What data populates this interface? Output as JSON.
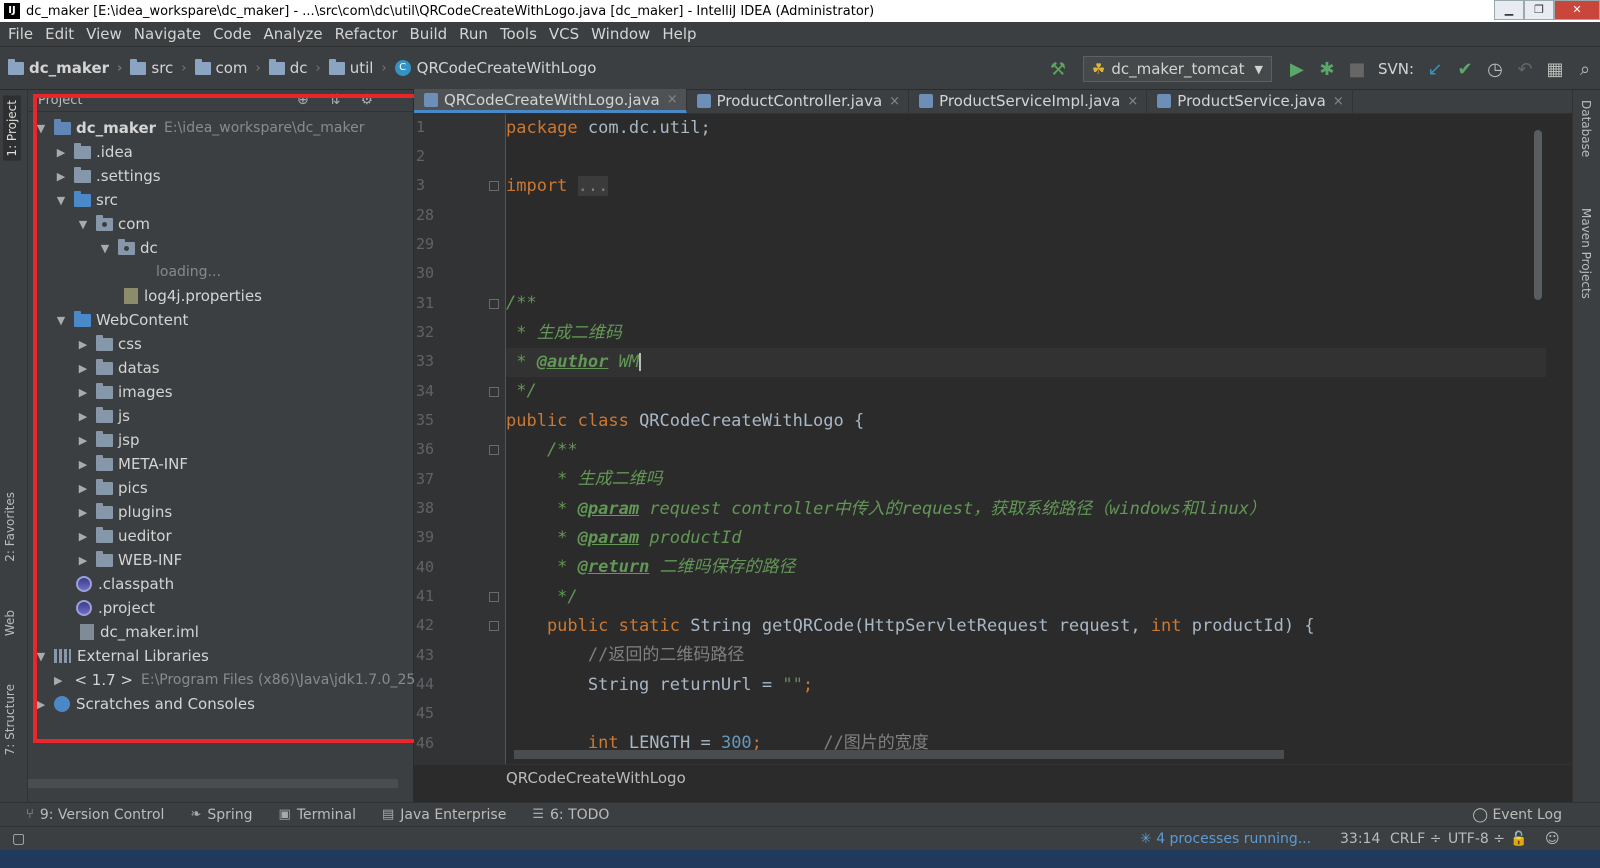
{
  "window": {
    "title": "dc_maker [E:\\idea_workspare\\dc_maker] - ...\\src\\com\\dc\\util\\QRCodeCreateWithLogo.java [dc_maker] - IntelliJ IDEA (Administrator)"
  },
  "menu": [
    "File",
    "Edit",
    "View",
    "Navigate",
    "Code",
    "Analyze",
    "Refactor",
    "Build",
    "Run",
    "Tools",
    "VCS",
    "Window",
    "Help"
  ],
  "navbar": {
    "crumbs": [
      "dc_maker",
      "src",
      "com",
      "dc",
      "util",
      "QRCodeCreateWithLogo"
    ],
    "run_config": "dc_maker_tomcat",
    "svn_label": "SVN:"
  },
  "left_stripe": {
    "project": "1: Project",
    "favorites": "2: Favorites",
    "web": "Web",
    "structure": "7: Structure"
  },
  "right_stripe": {
    "database": "Database",
    "maven": "Maven Projects"
  },
  "project_panel": {
    "header": "Project",
    "tree": [
      {
        "name": "dc_maker",
        "path": "E:\\idea_workspare\\dc_maker"
      },
      {
        "name": ".idea"
      },
      {
        "name": ".settings"
      },
      {
        "name": "src"
      },
      {
        "name": "com"
      },
      {
        "name": "dc"
      },
      {
        "name": "loading..."
      },
      {
        "name": "log4j.properties"
      },
      {
        "name": "WebContent"
      },
      {
        "name": "css"
      },
      {
        "name": "datas"
      },
      {
        "name": "images"
      },
      {
        "name": "js"
      },
      {
        "name": "jsp"
      },
      {
        "name": "META-INF"
      },
      {
        "name": "pics"
      },
      {
        "name": "plugins"
      },
      {
        "name": "ueditor"
      },
      {
        "name": "WEB-INF"
      },
      {
        "name": ".classpath"
      },
      {
        "name": ".project"
      },
      {
        "name": "dc_maker.iml"
      },
      {
        "name": "External Libraries"
      },
      {
        "name": "< 1.7 >",
        "path": "E:\\Program Files (x86)\\Java\\jdk1.7.0_25"
      },
      {
        "name": "Scratches and Consoles"
      }
    ]
  },
  "editor": {
    "tabs": [
      "QRCodeCreateWithLogo.java",
      "ProductController.java",
      "ProductServiceImpl.java",
      "ProductService.java"
    ],
    "line_numbers": [
      "1",
      "2",
      "3",
      "28",
      "29",
      "30",
      "31",
      "32",
      "33",
      "34",
      "35",
      "36",
      "37",
      "38",
      "39",
      "40",
      "41",
      "42",
      "43",
      "44",
      "45",
      "46"
    ],
    "code": {
      "l1_kw": "package",
      "l1_rest": " com.dc.util;",
      "l3_kw": "import",
      "l3_fold": "...",
      "l7": "/**",
      "l8": " * 生成二维码",
      "l9_pre": " * ",
      "l9_tag": "@author",
      "l9_val": " WM",
      "l10": " */",
      "l11_kw": "public class",
      "l11_rest": " QRCodeCreateWithLogo {",
      "l12": "    /**",
      "l13": "     * 生成二维吗",
      "l14_pre": "     * ",
      "l14_tag": "@param",
      "l14_rest": " request controller中传入的request，获取系统路径（windows和linux）",
      "l15_pre": "     * ",
      "l15_tag": "@param",
      "l15_rest": " productId",
      "l16_pre": "     * ",
      "l16_tag": "@return",
      "l16_rest": " 二维吗保存的路径",
      "l17": "     */",
      "l18_kw": "    public static",
      "l18_a": " String getQRCode(HttpServletRequest request, ",
      "l18_kw2": "int",
      "l18_b": " productId) {",
      "l19": "        //返回的二维码路径",
      "l20_a": "        String returnUrl = ",
      "l20_str": "\"\"",
      "l20_b": ";",
      "l22_kw": "        int",
      "l22_a": " LENGTH = ",
      "l22_num": "300",
      "l22_b": ";",
      "l22_cmt": "      //图片的宽度"
    },
    "breadcrumb": "QRCodeCreateWithLogo"
  },
  "tool_windows": [
    "9: Version Control",
    "Spring",
    "Terminal",
    "Java Enterprise",
    "6: TODO"
  ],
  "event_log": "Event Log",
  "status": {
    "processes": "4 processes running...",
    "position": "33:14",
    "line_sep": "CRLF ÷",
    "encoding": "UTF-8 ÷"
  }
}
